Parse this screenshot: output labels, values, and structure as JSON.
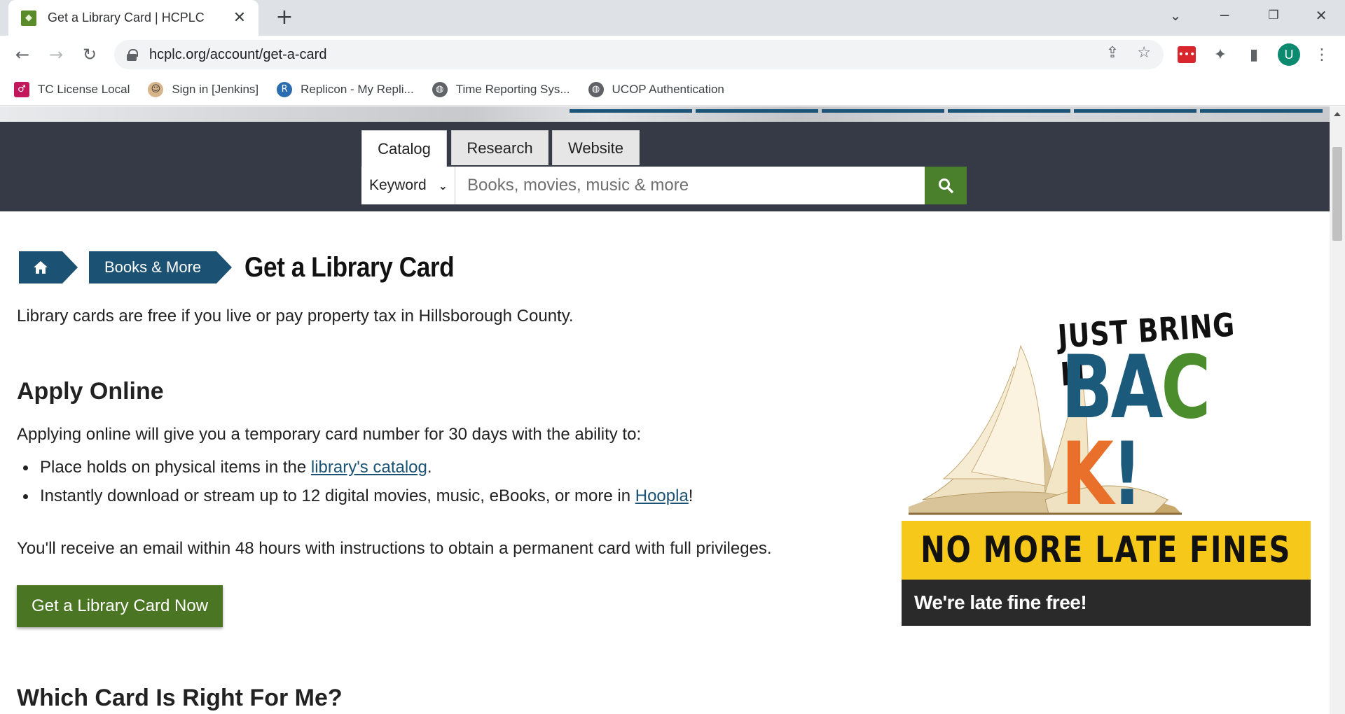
{
  "browser": {
    "tab_title": "Get a Library Card | HCPLC",
    "url": "hcplc.org/account/get-a-card",
    "avatar_letter": "U",
    "bookmarks": [
      {
        "label": "TC License Local",
        "icon": "tc-icon"
      },
      {
        "label": "Sign in [Jenkins]",
        "icon": "jenkins-icon"
      },
      {
        "label": "Replicon - My Repli...",
        "icon": "replicon-icon"
      },
      {
        "label": "Time Reporting Sys...",
        "icon": "globe-icon"
      },
      {
        "label": "UCOP Authentication",
        "icon": "globe-icon"
      }
    ]
  },
  "search": {
    "tabs": [
      "Catalog",
      "Research",
      "Website"
    ],
    "active_tab": "Catalog",
    "type_selected": "Keyword",
    "placeholder": "Books, movies, music & more",
    "button_icon": "search-icon"
  },
  "breadcrumb": {
    "home_icon": "home-icon",
    "section": "Books & More",
    "current": "Get a Library Card"
  },
  "content": {
    "intro": "Library cards are free if you live or pay property tax in Hillsborough County.",
    "apply_heading": "Apply Online",
    "apply_text": "Applying online will give you a temporary card number for 30 days with the ability to:",
    "benefit1_pre": "Place holds on physical items in the ",
    "benefit1_link": "library's catalog",
    "benefit1_post": ".",
    "benefit2_pre": "Instantly download or stream up to 12 digital movies, music, eBooks, or more in ",
    "benefit2_link": "Hoopla",
    "benefit2_post": "!",
    "email_text": "You'll receive an email within 48 hours with instructions to obtain a permanent card with full privileges.",
    "cta": "Get a Library Card Now",
    "which_heading": "Which Card Is Right For Me?"
  },
  "promo": {
    "top": "JUST BRING IT",
    "back_letters": [
      "B",
      "A",
      "C",
      "K",
      "!"
    ],
    "back_colors": [
      "#1c5a7c",
      "#1c5a7c",
      "#4b8c2c",
      "#e8702a",
      "#1c5a7c"
    ],
    "banner": "NO MORE LATE FINES",
    "caption": "We're late fine free!"
  },
  "colors": {
    "brand_blue": "#1b5273",
    "brand_green": "#4a7624",
    "search_band": "#353a46",
    "promo_yellow": "#f6c81a"
  }
}
